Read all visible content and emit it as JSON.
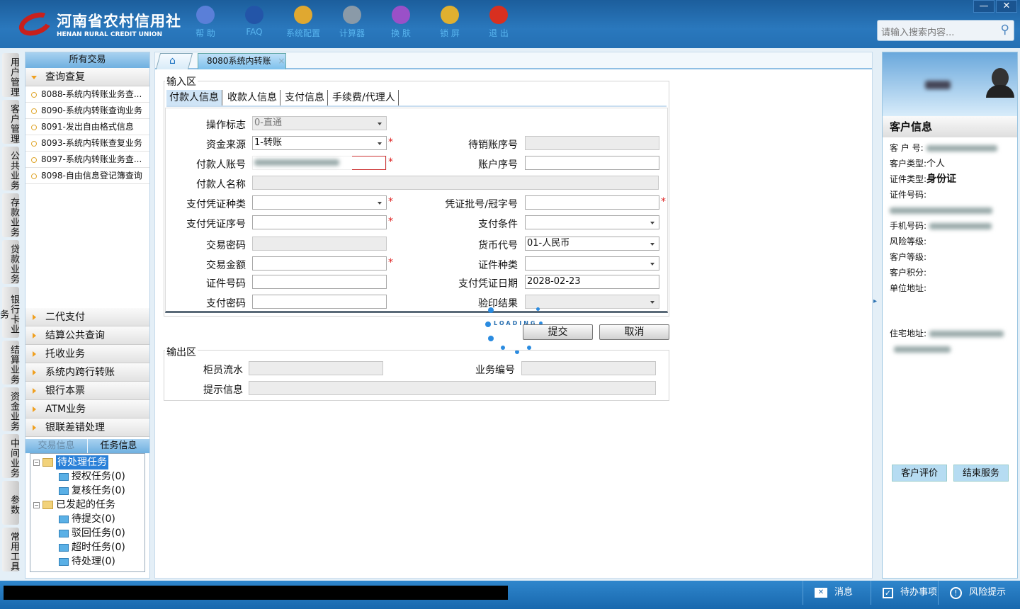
{
  "header": {
    "logo_cn": "河南省农村信用社",
    "logo_en": "HENAN RURAL CREDIT UNION",
    "tools": [
      {
        "label": "帮 助",
        "icon": "info-icon",
        "color": "#5a7fd8"
      },
      {
        "label": "FAQ",
        "icon": "question-icon",
        "color": "#2355a8"
      },
      {
        "label": "系统配置",
        "icon": "toolbox-icon",
        "color": "#e0a830"
      },
      {
        "label": "计算器",
        "icon": "calculator-icon",
        "color": "#8a9aa8"
      },
      {
        "label": "换 肤",
        "icon": "shirt-icon",
        "color": "#9a50c8"
      },
      {
        "label": "锁 屏",
        "icon": "lock-icon",
        "color": "#e0b030"
      },
      {
        "label": "退 出",
        "icon": "power-icon",
        "color": "#d83020"
      }
    ],
    "minimize": "—",
    "close": "✕",
    "search_placeholder": "请输入搜索内容..."
  },
  "vtabs": [
    "用户管理",
    "客户管理",
    "公共业务",
    "存款业务",
    "贷款业务",
    "银行卡业务",
    "结算业务",
    "资金业务",
    "中间业务",
    "参数",
    "常用工具"
  ],
  "left": {
    "title": "所有交易",
    "open_group": "查询查复",
    "items": [
      "8088-系统内转账业务查...",
      "8090-系统内转账查询业务",
      "8091-发出自由格式信息",
      "8093-系统内转账查复业务",
      "8097-系统内转账业务查...",
      "8098-自由信息登记簿查询"
    ],
    "groups": [
      "二代支付",
      "结算公共查询",
      "托收业务",
      "系统内跨行转账",
      "银行本票",
      "ATM业务",
      "银联差错处理"
    ],
    "task_tabs": [
      "交易信息",
      "任务信息"
    ],
    "tree": [
      {
        "label": "待处理任务",
        "children": [
          "授权任务(0)",
          "复核任务(0)"
        ]
      },
      {
        "label": "已发起的任务",
        "children": [
          "待提交(0)",
          "驳回任务(0)",
          "超时任务(0)",
          "待处理(0)"
        ]
      }
    ]
  },
  "main": {
    "tab": "8080系统内转账",
    "tab_close": "×",
    "input_area": "输入区",
    "output_area": "输出区",
    "subtabs": [
      "付款人信息",
      "收款人信息",
      "支付信息",
      "手续费/代理人"
    ],
    "fields": {
      "op_flag": {
        "label": "操作标志",
        "value": "0-直通"
      },
      "fund_src": {
        "label": "资金来源",
        "value": "1-转账"
      },
      "pending_seq": {
        "label": "待销账序号",
        "value": ""
      },
      "payer_acct": {
        "label": "付款人账号"
      },
      "acct_seq": {
        "label": "账户序号",
        "value": ""
      },
      "payer_name": {
        "label": "付款人名称",
        "value": ""
      },
      "voucher_type": {
        "label": "支付凭证种类",
        "value": ""
      },
      "voucher_batch": {
        "label": "凭证批号/冠字号",
        "value": ""
      },
      "voucher_no": {
        "label": "支付凭证序号",
        "value": ""
      },
      "pay_cond": {
        "label": "支付条件",
        "value": ""
      },
      "tx_pwd": {
        "label": "交易密码",
        "value": ""
      },
      "currency": {
        "label": "货币代号",
        "value": "01-人民币"
      },
      "amount": {
        "label": "交易金额",
        "value": ""
      },
      "id_type": {
        "label": "证件种类",
        "value": ""
      },
      "id_no": {
        "label": "证件号码",
        "value": ""
      },
      "voucher_date": {
        "label": "支付凭证日期",
        "value": "2028-02-23"
      },
      "pay_pwd": {
        "label": "支付密码",
        "value": ""
      },
      "seal_result": {
        "label": "验印结果",
        "value": ""
      }
    },
    "required": "*",
    "loading": "LOADING",
    "submit": "提交",
    "cancel": "取消",
    "out": {
      "teller_serial": "柜员流水",
      "biz_no": "业务编号",
      "hint": "提示信息"
    }
  },
  "right": {
    "title": "客户信息",
    "rows": {
      "cust_no": "客 户 号:",
      "cust_type": "客户类型:",
      "cust_type_v": "个人",
      "id_type": "证件类型:",
      "id_type_v": "身份证",
      "id_no": "证件号码:",
      "mobile": "手机号码:",
      "risk": "风险等级:",
      "level": "客户等级:",
      "points": "客户积分:",
      "work_addr": "单位地址:",
      "home_addr": "住宅地址:"
    },
    "eval": "客户评价",
    "end": "结束服务"
  },
  "status": {
    "message": "消息",
    "todo": "待办事项",
    "risk": "风险提示"
  }
}
